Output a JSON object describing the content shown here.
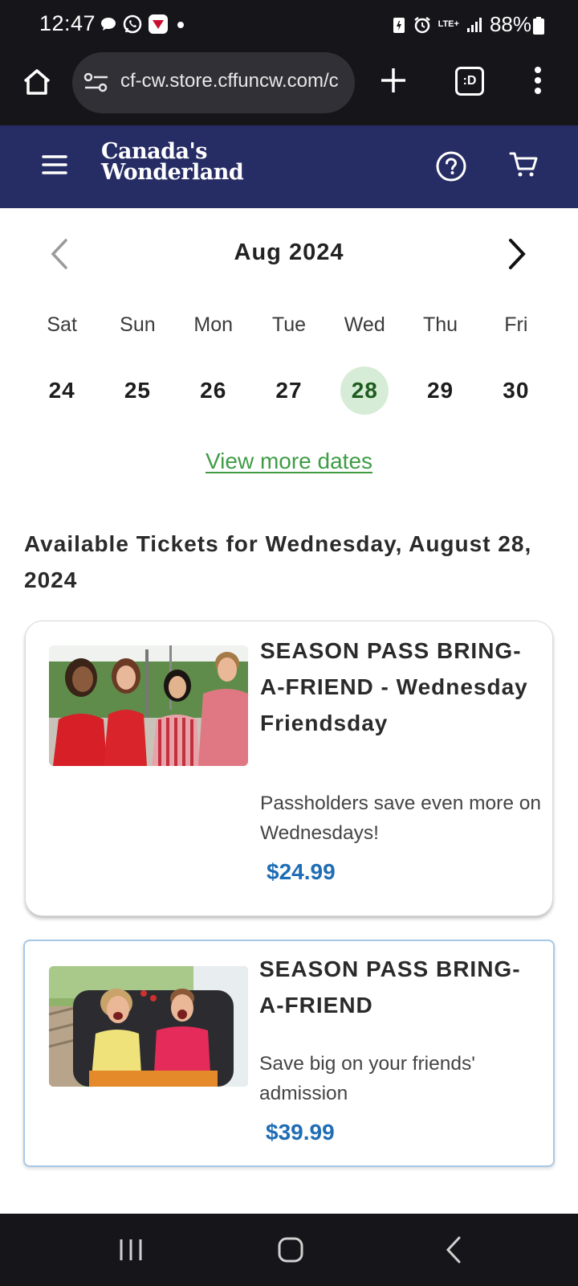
{
  "status_bar": {
    "time": "12:47",
    "battery": "88%",
    "network": "LTE+",
    "icons": [
      "chat-bubble-icon",
      "whatsapp-icon",
      "app-notification-icon",
      "dot-icon",
      "battery-saver-icon",
      "alarm-icon",
      "signal-icon",
      "battery-icon"
    ]
  },
  "browser": {
    "url": "cf-cw.store.cffuncw.com/c",
    "tabs_label": ":D"
  },
  "site_header": {
    "logo_line1": "Canada's",
    "logo_line2": "Wonderland"
  },
  "calendar": {
    "month_label": "Aug 2024",
    "days": [
      {
        "dow": "Sat",
        "date": "24"
      },
      {
        "dow": "Sun",
        "date": "25"
      },
      {
        "dow": "Mon",
        "date": "26"
      },
      {
        "dow": "Tue",
        "date": "27"
      },
      {
        "dow": "Wed",
        "date": "28"
      },
      {
        "dow": "Thu",
        "date": "29"
      },
      {
        "dow": "Fri",
        "date": "30"
      }
    ],
    "selected_date": "28",
    "view_more_label": "View more dates"
  },
  "available_title": "Available Tickets for Wednesday, August 28, 2024",
  "tickets": [
    {
      "title": "SEASON PASS BRING-A-FRIEND - Wednesday Friendsday",
      "description": "Passholders save even more on Wednesdays!",
      "price": "$24.99"
    },
    {
      "title": "SEASON PASS BRING-A-FRIEND",
      "description": "Save big on your friends' admission",
      "price": "$39.99"
    }
  ],
  "colors": {
    "header_bg": "#262c64",
    "selected_date_bg": "#d7ecd7",
    "link_green": "#3f9c45",
    "price_blue": "#1f6db4"
  }
}
